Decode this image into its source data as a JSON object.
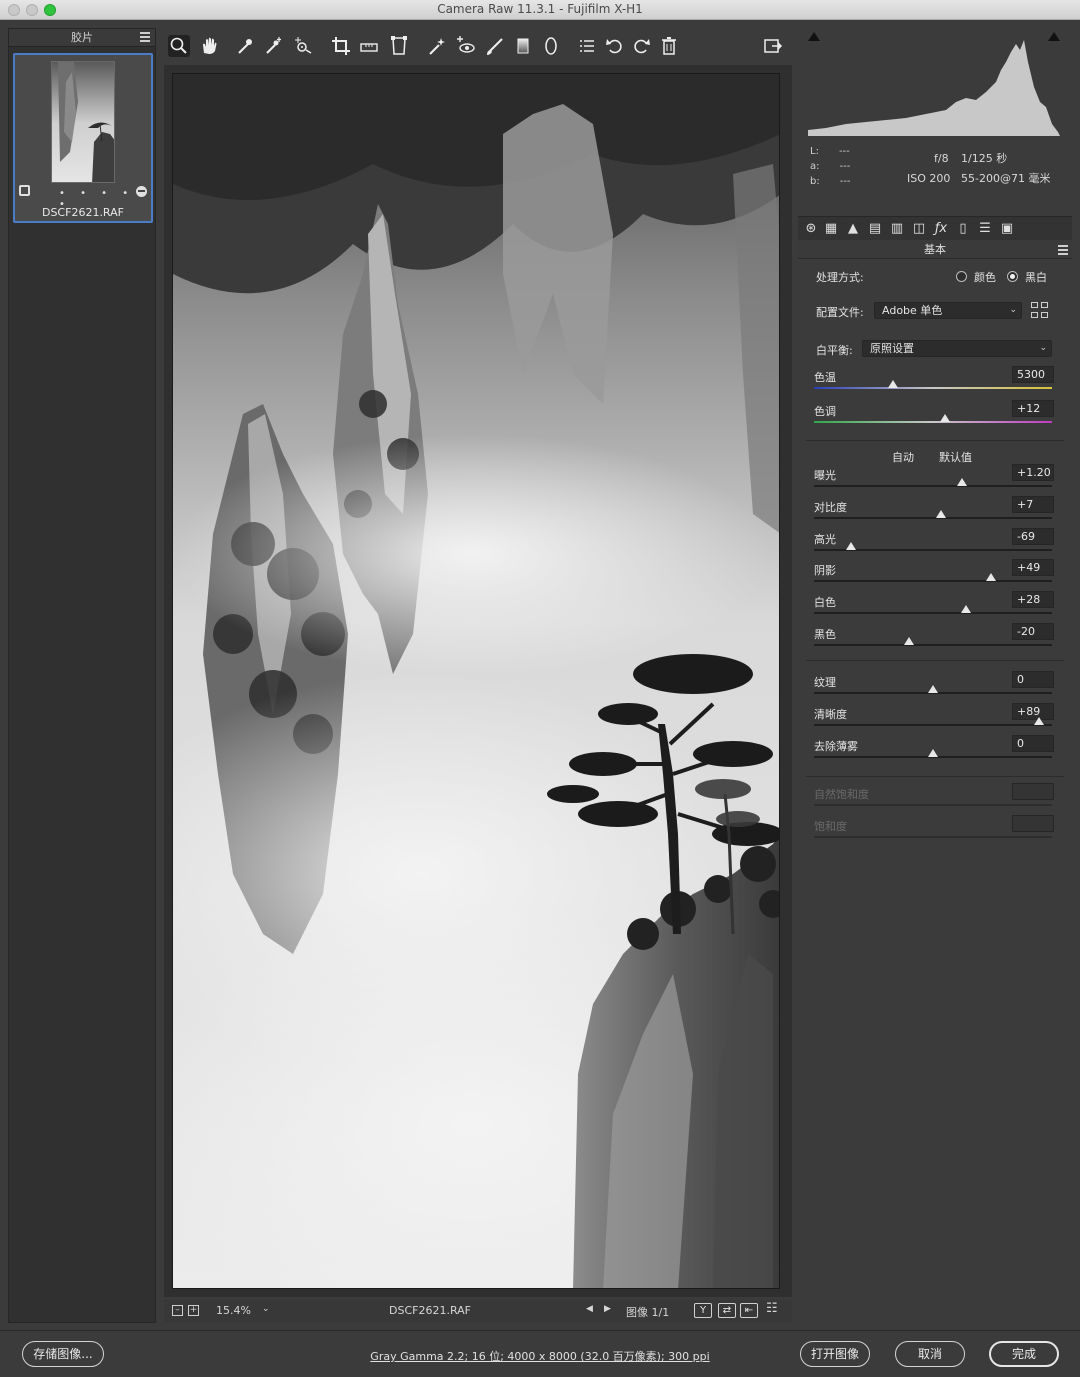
{
  "window": {
    "title": "Camera Raw 11.3.1 -  Fujifilm X-H1"
  },
  "filmstrip": {
    "header": "胶片",
    "items": [
      {
        "filename": "DSCF2621.RAF",
        "rating_dots": "• • • • •"
      }
    ]
  },
  "toolbar": {
    "tools": [
      {
        "name": "zoom-tool",
        "icon": "magnifier-icon",
        "glyph": "🔍",
        "active": true
      },
      {
        "name": "hand-tool",
        "icon": "hand-icon",
        "glyph": "✋"
      },
      {
        "name": "white-balance-tool",
        "icon": "eyedropper-icon",
        "glyph": "✎"
      },
      {
        "name": "color-sampler-tool",
        "icon": "sampler-icon",
        "glyph": "✒"
      },
      {
        "name": "targeted-adjustment-tool",
        "icon": "target-icon",
        "glyph": "⊙"
      },
      {
        "name": "crop-tool",
        "icon": "crop-icon",
        "glyph": "⌗"
      },
      {
        "name": "straighten-tool",
        "icon": "level-icon",
        "glyph": "▭"
      },
      {
        "name": "transform-tool",
        "icon": "transform-icon",
        "glyph": "⌸"
      },
      {
        "name": "spot-removal-tool",
        "icon": "spot-icon",
        "glyph": "✱"
      },
      {
        "name": "red-eye-tool",
        "icon": "eye-icon",
        "glyph": "◉"
      },
      {
        "name": "adjustment-brush-tool",
        "icon": "brush-icon",
        "glyph": "╱"
      },
      {
        "name": "graduated-filter-tool",
        "icon": "gradient-icon",
        "glyph": "▮"
      },
      {
        "name": "radial-filter-tool",
        "icon": "ellipse-icon",
        "glyph": "⬭"
      },
      {
        "name": "preferences-tool",
        "icon": "list-icon",
        "glyph": "☰"
      },
      {
        "name": "rotate-left-tool",
        "icon": "rotate-ccw-icon",
        "glyph": "↺"
      },
      {
        "name": "rotate-right-tool",
        "icon": "rotate-cw-icon",
        "glyph": "↻"
      },
      {
        "name": "delete-tool",
        "icon": "trash-icon",
        "glyph": "🗑"
      }
    ],
    "fullscreen_icon": "fullscreen-icon"
  },
  "status": {
    "zoom": "15.4%",
    "filename": "DSCF2621.RAF",
    "image_counter": "图像 1/1"
  },
  "info": {
    "L": "L:",
    "L_val": "---",
    "a": "a:",
    "a_val": "---",
    "b": "b:",
    "b_val": "---",
    "aperture": "f/8",
    "shutter": "1/125 秒",
    "iso": "ISO 200",
    "lens": "55-200@71 毫米"
  },
  "panel": {
    "title": "基本",
    "treatment_label": "处理方式:",
    "treatment_color": "颜色",
    "treatment_bw": "黑白",
    "treatment_selected": "黑白",
    "profile_label": "配置文件:",
    "profile_value": "Adobe 单色",
    "wb_label": "白平衡:",
    "wb_value": "原照设置",
    "auto_link": "自动",
    "default_link": "默认值",
    "sliders": [
      {
        "id": "temp",
        "label": "色温",
        "value": "5300",
        "pos": 0.33,
        "track": "temp"
      },
      {
        "id": "tint",
        "label": "色调",
        "value": "+12",
        "pos": 0.55,
        "track": "tint"
      },
      {
        "id": "exposure",
        "label": "曝光",
        "value": "+1.20",
        "pos": 0.62
      },
      {
        "id": "contrast",
        "label": "对比度",
        "value": "+7",
        "pos": 0.535
      },
      {
        "id": "highlights",
        "label": "高光",
        "value": "-69",
        "pos": 0.155
      },
      {
        "id": "shadows",
        "label": "阴影",
        "value": "+49",
        "pos": 0.745
      },
      {
        "id": "whites",
        "label": "白色",
        "value": "+28",
        "pos": 0.64
      },
      {
        "id": "blacks",
        "label": "黑色",
        "value": "-20",
        "pos": 0.4
      },
      {
        "id": "texture",
        "label": "纹理",
        "value": "0",
        "pos": 0.5
      },
      {
        "id": "clarity",
        "label": "清晰度",
        "value": "+89",
        "pos": 0.945
      },
      {
        "id": "dehaze",
        "label": "去除薄雾",
        "value": "0",
        "pos": 0.5
      },
      {
        "id": "vibrance",
        "label": "自然饱和度",
        "value": "",
        "pos": null,
        "disabled": true
      },
      {
        "id": "saturation",
        "label": "饱和度",
        "value": "",
        "pos": null,
        "disabled": true
      }
    ]
  },
  "footer": {
    "save_label": "存储图像...",
    "workflow_text": "Gray Gamma 2.2; 16 位; 4000 x 8000 (32.0 百万像素); 300 ppi",
    "open_label": "打开图像",
    "cancel_label": "取消",
    "done_label": "完成"
  }
}
